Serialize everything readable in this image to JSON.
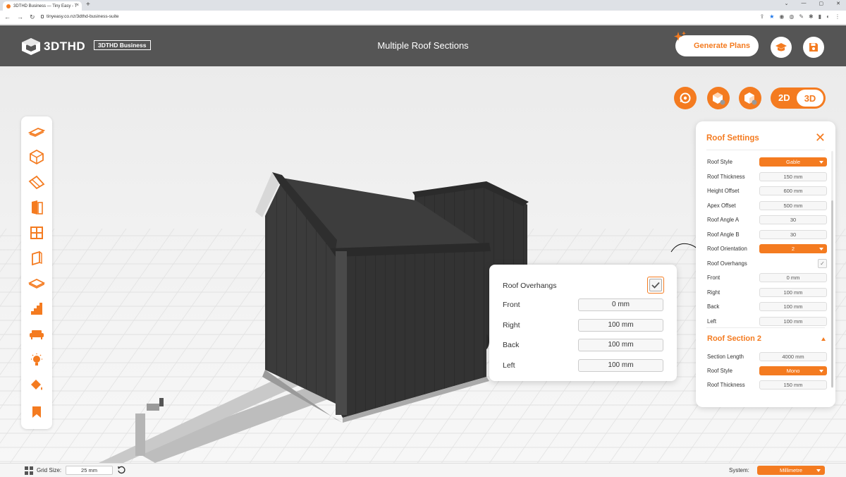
{
  "browser": {
    "tab_title": "3DTHD Business — Tiny Easy - T",
    "tab_close": "×",
    "new_tab": "+",
    "url": "tinyeasy.co.nz/3dthd-business-suite",
    "window_controls": [
      "⌄",
      "—",
      "▢",
      "✕"
    ]
  },
  "header": {
    "logo_text": "3DTHD",
    "badge": "3DTHD Business",
    "title": "Multiple Roof Sections",
    "generate_label": "Generate Plans"
  },
  "view_toggle": {
    "label_2d": "2D",
    "label_3d": "3D"
  },
  "roof_panel": {
    "title": "Roof Settings",
    "close": "✕",
    "rows": [
      {
        "label": "Roof Style",
        "value": "Gable",
        "kind": "select"
      },
      {
        "label": "Roof Thickness",
        "value": "150 mm",
        "kind": "field"
      },
      {
        "label": "Height Offset",
        "value": "600 mm",
        "kind": "field"
      },
      {
        "label": "Apex Offset",
        "value": "500 mm",
        "kind": "field"
      },
      {
        "label": "Roof Angle A",
        "value": "30",
        "kind": "field"
      },
      {
        "label": "Roof Angle B",
        "value": "30",
        "kind": "field"
      },
      {
        "label": "Roof Orientation",
        "value": "2",
        "kind": "select"
      },
      {
        "label": "Roof Overhangs",
        "value": "✓",
        "kind": "check"
      },
      {
        "label": "Front",
        "value": "0 mm",
        "kind": "field"
      },
      {
        "label": "Right",
        "value": "100 mm",
        "kind": "field"
      },
      {
        "label": "Back",
        "value": "100 mm",
        "kind": "field"
      },
      {
        "label": "Left",
        "value": "100 mm",
        "kind": "field"
      }
    ],
    "section2_title": "Roof Section 2",
    "section2_rows": [
      {
        "label": "Section Length",
        "value": "4000 mm",
        "kind": "field"
      },
      {
        "label": "Roof Style",
        "value": "Mono",
        "kind": "select"
      },
      {
        "label": "Roof Thickness",
        "value": "150 mm",
        "kind": "field"
      }
    ]
  },
  "zoom_popup": {
    "overhangs_label": "Roof Overhangs",
    "rows": [
      {
        "label": "Front",
        "value": "0 mm"
      },
      {
        "label": "Right",
        "value": "100 mm"
      },
      {
        "label": "Back",
        "value": "100 mm"
      },
      {
        "label": "Left",
        "value": "100 mm"
      }
    ]
  },
  "statusbar": {
    "grid_label": "Grid Size:",
    "grid_value": "25 mm",
    "system_label": "System:",
    "system_value": "Millimetre"
  },
  "colors": {
    "accent": "#f47b20",
    "header": "#555555",
    "wall": "#3a3a3a"
  }
}
